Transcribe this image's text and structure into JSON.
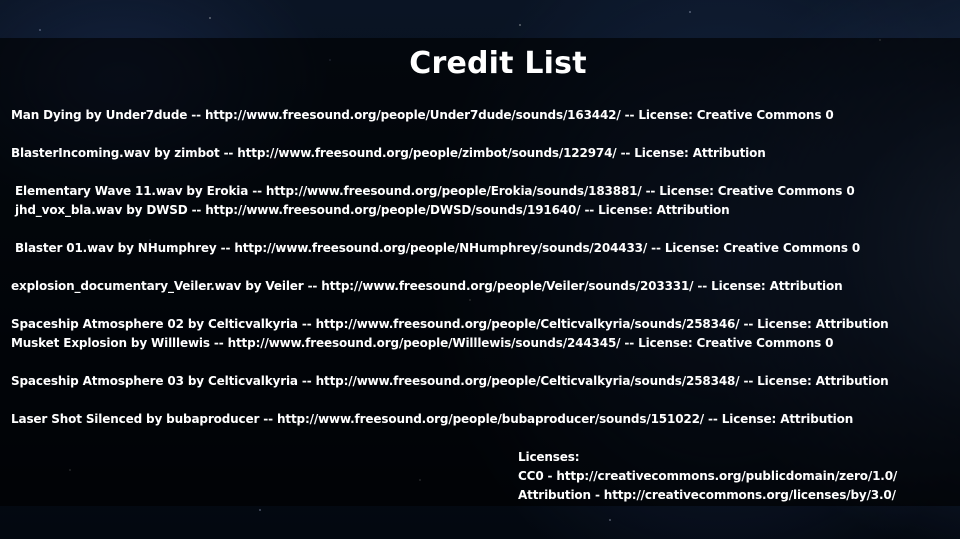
{
  "title": "Credit List",
  "credits": [
    "Man Dying by Under7dude -- http://www.freesound.org/people/Under7dude/sounds/163442/ -- License: Creative Commons 0",
    "BlasterIncoming.wav by zimbot -- http://www.freesound.org/people/zimbot/sounds/122974/ -- License: Attribution",
    "Elementary Wave 11.wav by Erokia -- http://www.freesound.org/people/Erokia/sounds/183881/ -- License: Creative Commons 0",
    "jhd_vox_bla.wav by DWSD -- http://www.freesound.org/people/DWSD/sounds/191640/ -- License: Attribution",
    "Blaster 01.wav by NHumphrey -- http://www.freesound.org/people/NHumphrey/sounds/204433/ -- License: Creative Commons 0",
    "explosion_documentary_Veiler.wav by Veiler -- http://www.freesound.org/people/Veiler/sounds/203331/ -- License: Attribution",
    "Spaceship Atmosphere 02 by Celticvalkyria -- http://www.freesound.org/people/Celticvalkyria/sounds/258346/ -- License: Attribution",
    "Musket Explosion by Willlewis -- http://www.freesound.org/people/Willlewis/sounds/244345/ -- License: Creative Commons 0",
    "Spaceship Atmosphere 03 by Celticvalkyria -- http://www.freesound.org/people/Celticvalkyria/sounds/258348/ -- License: Attribution",
    "Laser Shot Silenced by bubaproducer -- http://www.freesound.org/people/bubaproducer/sounds/151022/ -- License: Attribution"
  ],
  "licenses": {
    "heading": "Licenses:",
    "cc0": "CC0 - http://creativecommons.org/publicdomain/zero/1.0/",
    "attribution": "Attribution - http://creativecommons.org/licenses/by/3.0/"
  },
  "colors": {
    "text": "#ffffff",
    "overlay": "#000000"
  }
}
